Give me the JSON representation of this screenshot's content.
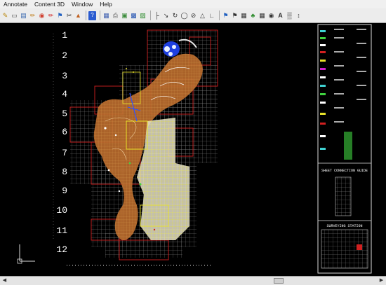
{
  "menu": {
    "items": [
      "Annotate",
      "Content 3D",
      "Window",
      "Help"
    ]
  },
  "toolbar": {
    "text_tool_label": "A"
  },
  "drawing": {
    "row_labels": [
      "1",
      "2",
      "3",
      "4",
      "5",
      "6",
      "7",
      "8",
      "9",
      "10",
      "11",
      "12"
    ],
    "legend_headers": {
      "sheet_connection": "SHEET CONNECTION GUIDE",
      "surveying_station": "SURVEYING STATION"
    },
    "colors": {
      "terrain": "#b86a2c",
      "grid_red": "#d12020",
      "grid_yellow": "#e8e22a",
      "fill_light": "#e6e2c8",
      "water": "#1d3fe0",
      "green": "#3fd23f"
    }
  },
  "icons": [
    "pencil-icon",
    "measure-icon",
    "layers-icon",
    "brush-icon",
    "palette-icon",
    "redline-icon",
    "flag-icon",
    "help-icon",
    "scissors-icon",
    "layout-icon",
    "print-icon",
    "stamp-icon",
    "cube-icon",
    "line-icon",
    "polyline-icon",
    "circle-icon",
    "no-entry-icon",
    "triangle-icon",
    "flag-blue-icon",
    "flag-grid-icon",
    "wedge-icon",
    "tree-icon",
    "grid-icon",
    "target-icon",
    "text-icon",
    "hatch-icon"
  ]
}
